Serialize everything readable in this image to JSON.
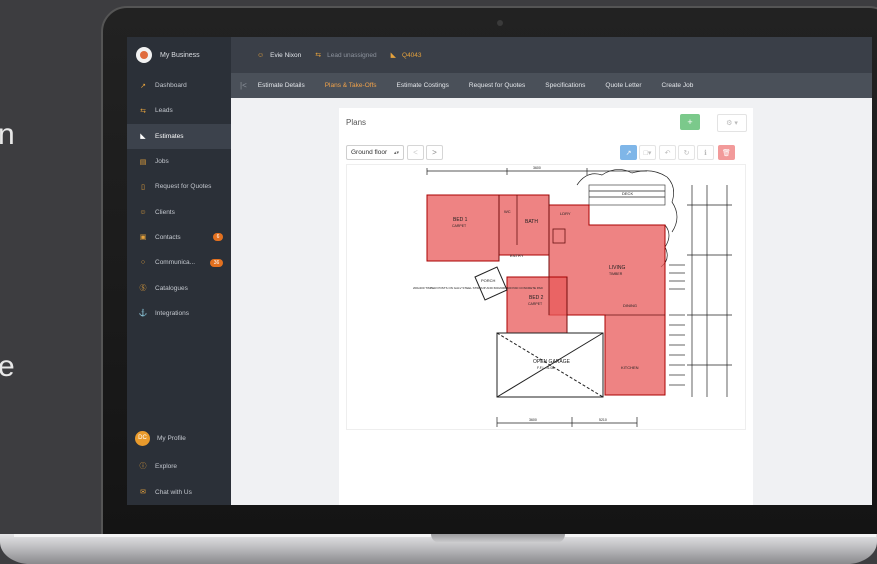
{
  "sidebar": {
    "brand": "My Business",
    "items": [
      {
        "label": "Dashboard",
        "icon": "chart-icon"
      },
      {
        "label": "Leads",
        "icon": "arrows-icon"
      },
      {
        "label": "Estimates",
        "icon": "ruler-icon",
        "active": true
      },
      {
        "label": "Jobs",
        "icon": "clipboard-icon"
      },
      {
        "label": "Request for Quotes",
        "icon": "document-icon"
      },
      {
        "label": "Clients",
        "icon": "person-icon"
      },
      {
        "label": "Contacts",
        "icon": "address-book-icon",
        "badge": "6"
      },
      {
        "label": "Communica...",
        "icon": "chat-bubble-icon",
        "badge": "36"
      },
      {
        "label": "Catalogues",
        "icon": "dollar-circle-icon"
      },
      {
        "label": "Integrations",
        "icon": "plug-icon"
      }
    ],
    "profile": {
      "initials": "DC",
      "label": "My Profile"
    },
    "explore": "Explore",
    "chat": "Chat with Us"
  },
  "topbar": {
    "client": "Evie Nixon",
    "lead_status": "Lead unassigned",
    "code": "Q4043"
  },
  "tabs": [
    {
      "label": "Estimate Details"
    },
    {
      "label": "Plans & Take-Offs",
      "active": true
    },
    {
      "label": "Estimate Costings"
    },
    {
      "label": "Request for Quotes"
    },
    {
      "label": "Specifications"
    },
    {
      "label": "Quote Letter"
    },
    {
      "label": "Create Job"
    }
  ],
  "plans": {
    "title": "Plans",
    "add_label": "+",
    "floor_select": "Ground floor",
    "prev": "<",
    "next": ">"
  },
  "plan_labels": {
    "bed1": "BED 1",
    "bed1_sub": "CARPET",
    "bath": "BATH",
    "wc": "WC",
    "ldry": "LDRY",
    "entry": "ENTRY",
    "porch": "PORCH",
    "bed2": "BED 2",
    "bed2_sub": "CARPET",
    "living": "LIVING",
    "living_sub": "TIMBER",
    "dining": "DINING",
    "kitchen": "KITCHEN",
    "garage": "OPEN GARAGE",
    "garage_sub": "F.F.L.=6.08",
    "deck": "DECK",
    "dim_top": "3600",
    "dim_bot1": "3600",
    "dim_bot2": "5210",
    "note": "200x200 TIMBER POSTS ON GALV STEEL STIRRUP AND 600x600x600 PAD CONCRETE PAD"
  },
  "colors": {
    "accent": "#f0a24a",
    "sidebar": "#2b3038",
    "highlight": "#e8595a",
    "add_button": "#7bc98b"
  }
}
